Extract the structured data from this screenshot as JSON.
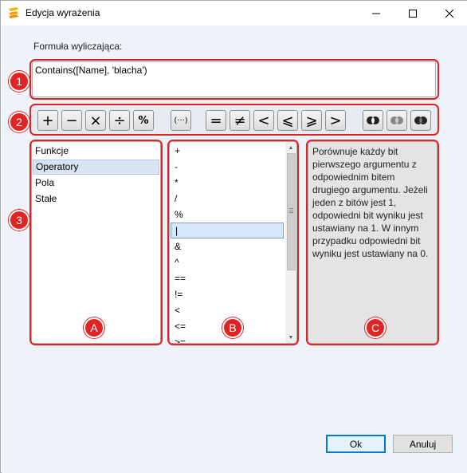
{
  "window": {
    "title": "Edycja wyrażenia"
  },
  "formula": {
    "label": "Formuła wyliczająca:",
    "value": "Contains([Name], 'blacha')"
  },
  "toolbar": {
    "arithmetic": [
      "+",
      "−",
      "×",
      "÷",
      "%"
    ],
    "grouping": "(···)",
    "comparison": [
      "=",
      "≠",
      "<",
      "⩽",
      "⩾",
      ">"
    ],
    "bitwise_icons": [
      "bitwise-and-icon",
      "bitwise-or-icon",
      "bitwise-xor-icon"
    ]
  },
  "categories": {
    "items": [
      "Funkcje",
      "Operatory",
      "Pola",
      "Stałe"
    ],
    "selected": "Operatory"
  },
  "operators": {
    "items": [
      "+",
      "-",
      "*",
      "/",
      "%",
      "|",
      "&",
      "^",
      "==",
      "!=",
      "<",
      "<=",
      ">="
    ],
    "selected": "|"
  },
  "description": "Porównuje każdy bit\npierwszego argumentu z\nodpowiednim bitem\ndrugiego argumentu. Jeżeli\njeden z bitów jest 1,\nodpowiedni bit wyniku jest\nustawiany na 1. W innym\nprzypadku odpowiedni bit\nwyniku jest ustawiany na 0.",
  "callouts": {
    "formula": "1",
    "toolbar": "2",
    "lists": "3",
    "list_a": "A",
    "list_b": "B",
    "list_c": "C"
  },
  "buttons": {
    "ok": "Ok",
    "cancel": "Anuluj"
  },
  "colors": {
    "annotation_red": "#e02424",
    "accent": "#0078d7",
    "selection": "#d5e6fb"
  }
}
